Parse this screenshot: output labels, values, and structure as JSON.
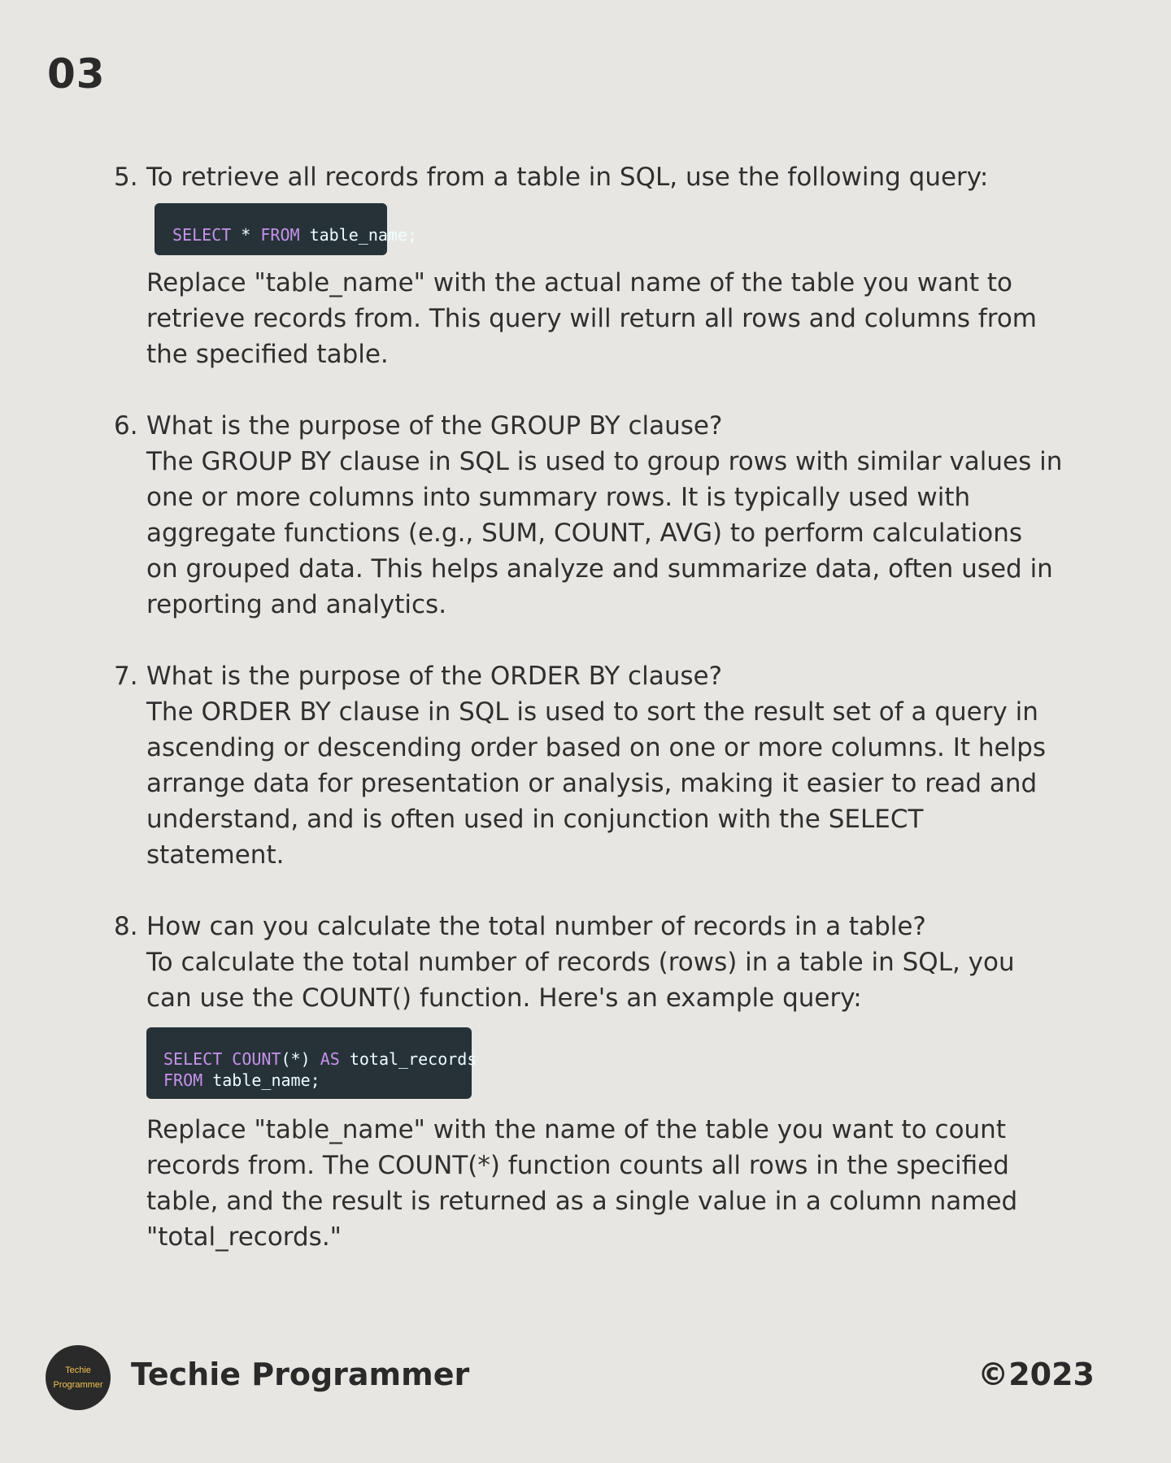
{
  "page_number": "03",
  "items": [
    {
      "number": "5.",
      "question": "To retrieve all records from a table in SQL, use the following query:",
      "code": {
        "line1": {
          "kw1": "SELECT",
          "t1": " * ",
          "kw2": "FROM",
          "t2": " table_name;"
        }
      },
      "after_code": "Replace \"table_name\" with the actual name of the table you want to\nretrieve records from. This query will return all rows and columns from\nthe specified table."
    },
    {
      "number": "6.",
      "question": "What is the purpose of the GROUP BY clause?",
      "answer": "The GROUP BY clause in SQL is used to group rows with similar values in\none or more columns into summary rows. It is typically used with\naggregate functions (e.g., SUM, COUNT, AVG) to perform calculations\non grouped data. This helps analyze and summarize data, often used in\nreporting and analytics."
    },
    {
      "number": "7.",
      "question": "What is the purpose of the ORDER BY clause?",
      "answer": "The ORDER BY clause in SQL is used to sort the result set of a query in\nascending or descending order based on one or more columns. It helps\narrange data for presentation or analysis, making it easier to read and\nunderstand, and is often used in conjunction with the SELECT\nstatement."
    },
    {
      "number": "8.",
      "question": "How can you calculate the total number of records in a table?",
      "answer": "To calculate the total number of records (rows) in a table in SQL, you\ncan use the COUNT() function. Here's an example query:",
      "code": {
        "line1": {
          "kw1": "SELECT",
          "t1": " ",
          "kw2": "COUNT",
          "t2": "(*) ",
          "kw3": "AS",
          "t3": " total_records"
        },
        "line2": {
          "kw1": "FROM",
          "t1": " table_name;"
        }
      },
      "after_code": "Replace \"table_name\" with the name of the table you want to count\nrecords from. The COUNT(*) function counts all rows in the specified\ntable, and the result is returned as a single value in a column named\n\"total_records.\""
    }
  ],
  "footer": {
    "logo_line1": "Techie",
    "logo_line2": "Programmer",
    "brand": "Techie Programmer",
    "copyright": "©2023"
  },
  "colors": {
    "background": "#e8e6e2",
    "code_background": "#263238",
    "code_keyword": "#c792ea",
    "logo_text": "#f2c14e"
  }
}
